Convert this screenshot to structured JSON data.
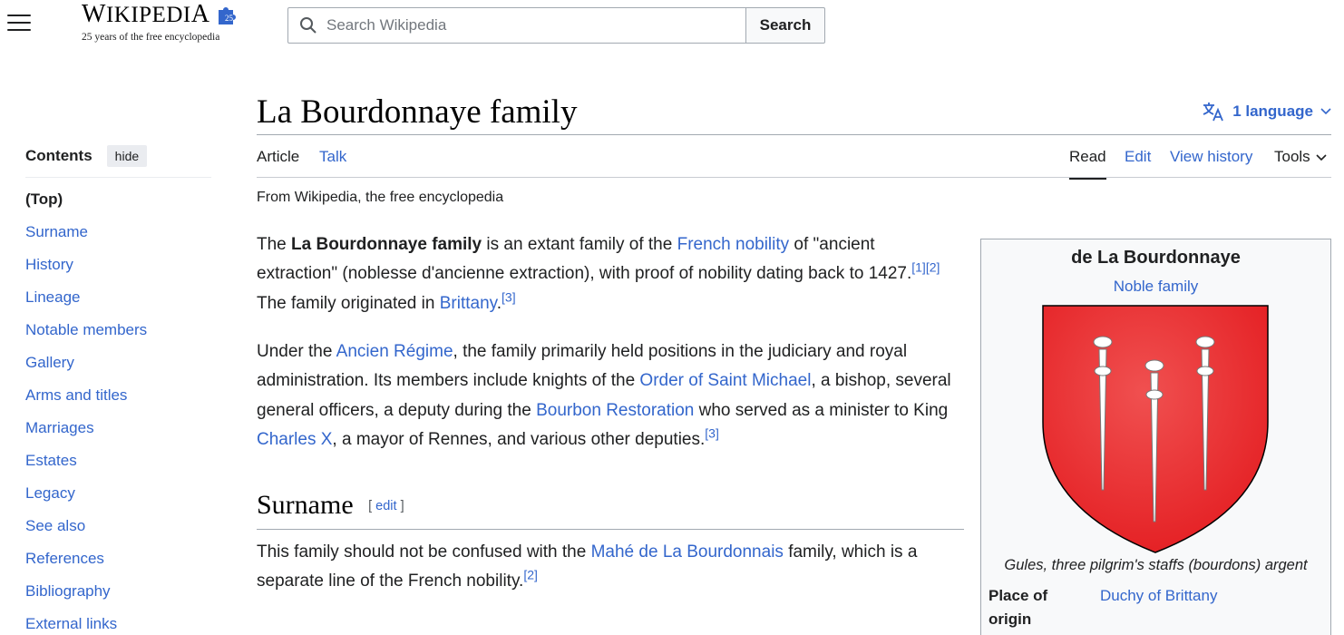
{
  "header": {
    "wordmark": "WIKIPEDIA",
    "anniversary_badge": "25",
    "tagline": "25 years of the free encyclopedia",
    "search_placeholder": "Search Wikipedia",
    "search_button": "Search",
    "icons": [
      "menu-icon",
      "puzzle-globe-icon",
      "search-icon"
    ]
  },
  "page": {
    "title": "La Bourdonnaye family",
    "language_label": "1 language",
    "tabs_left": [
      "Article",
      "Talk"
    ],
    "tabs_right": [
      "Read",
      "Edit",
      "View history",
      "Tools"
    ],
    "selected_tabs": [
      "Article",
      "Read"
    ],
    "from": "From Wikipedia, the free encyclopedia"
  },
  "toc": {
    "title": "Contents",
    "hide_label": "hide",
    "items": [
      "(Top)",
      "Surname",
      "History",
      "Lineage",
      "Notable members",
      "Gallery",
      "Arms and titles",
      "Marriages",
      "Estates",
      "Legacy",
      "See also",
      "References",
      "Bibliography",
      "External links"
    ]
  },
  "content": {
    "p1": {
      "t1": "The ",
      "bold": "La Bourdonnaye family",
      "t2": " is an extant family of the ",
      "link1": "French nobility",
      "t3": " of \"ancient extraction\" (noblesse d'ancienne extraction), with proof of nobility dating back to 1427.",
      "ref1": "[1]",
      "ref2": "[2]",
      "t4": " The family originated in ",
      "link2": "Brittany",
      "t5": ".",
      "ref3": "[3]"
    },
    "p2": {
      "t1": "Under the ",
      "link1": "Ancien Régime",
      "t2": ", the family primarily held positions in the judiciary and royal administration. Its members include knights of the ",
      "link2": "Order of Saint Michael",
      "t3": ", a bishop, several general officers, a deputy during the ",
      "link3": "Bourbon Restoration",
      "t4": " who served as a minister to King ",
      "link4": "Charles X",
      "t5": ", a mayor of Rennes, and various other deputies.",
      "ref1": "[3]"
    },
    "section": {
      "heading": "Surname",
      "edit_open": "[ ",
      "edit_label": "edit",
      "edit_close": " ]"
    },
    "p3": {
      "t1": "This family should not be confused with the ",
      "link1": "Mahé de La Bourdonnais",
      "t2": " family, which is a separate line of the French nobility.",
      "ref1": "[2]"
    }
  },
  "infobox": {
    "title": "de La Bourdonnaye",
    "subtitle": "Noble family",
    "caption": "Gules, three pilgrim's staffs (bourdons) argent",
    "place_label": "Place of origin",
    "place_value": "Duchy of Brittany",
    "shield_color": "#e41e22",
    "charge_color": "#ffffff"
  },
  "colors": {
    "link": "#3366cc",
    "text": "#202122",
    "border": "#a2a9b1",
    "infobox_bg": "#f8f9fa"
  }
}
